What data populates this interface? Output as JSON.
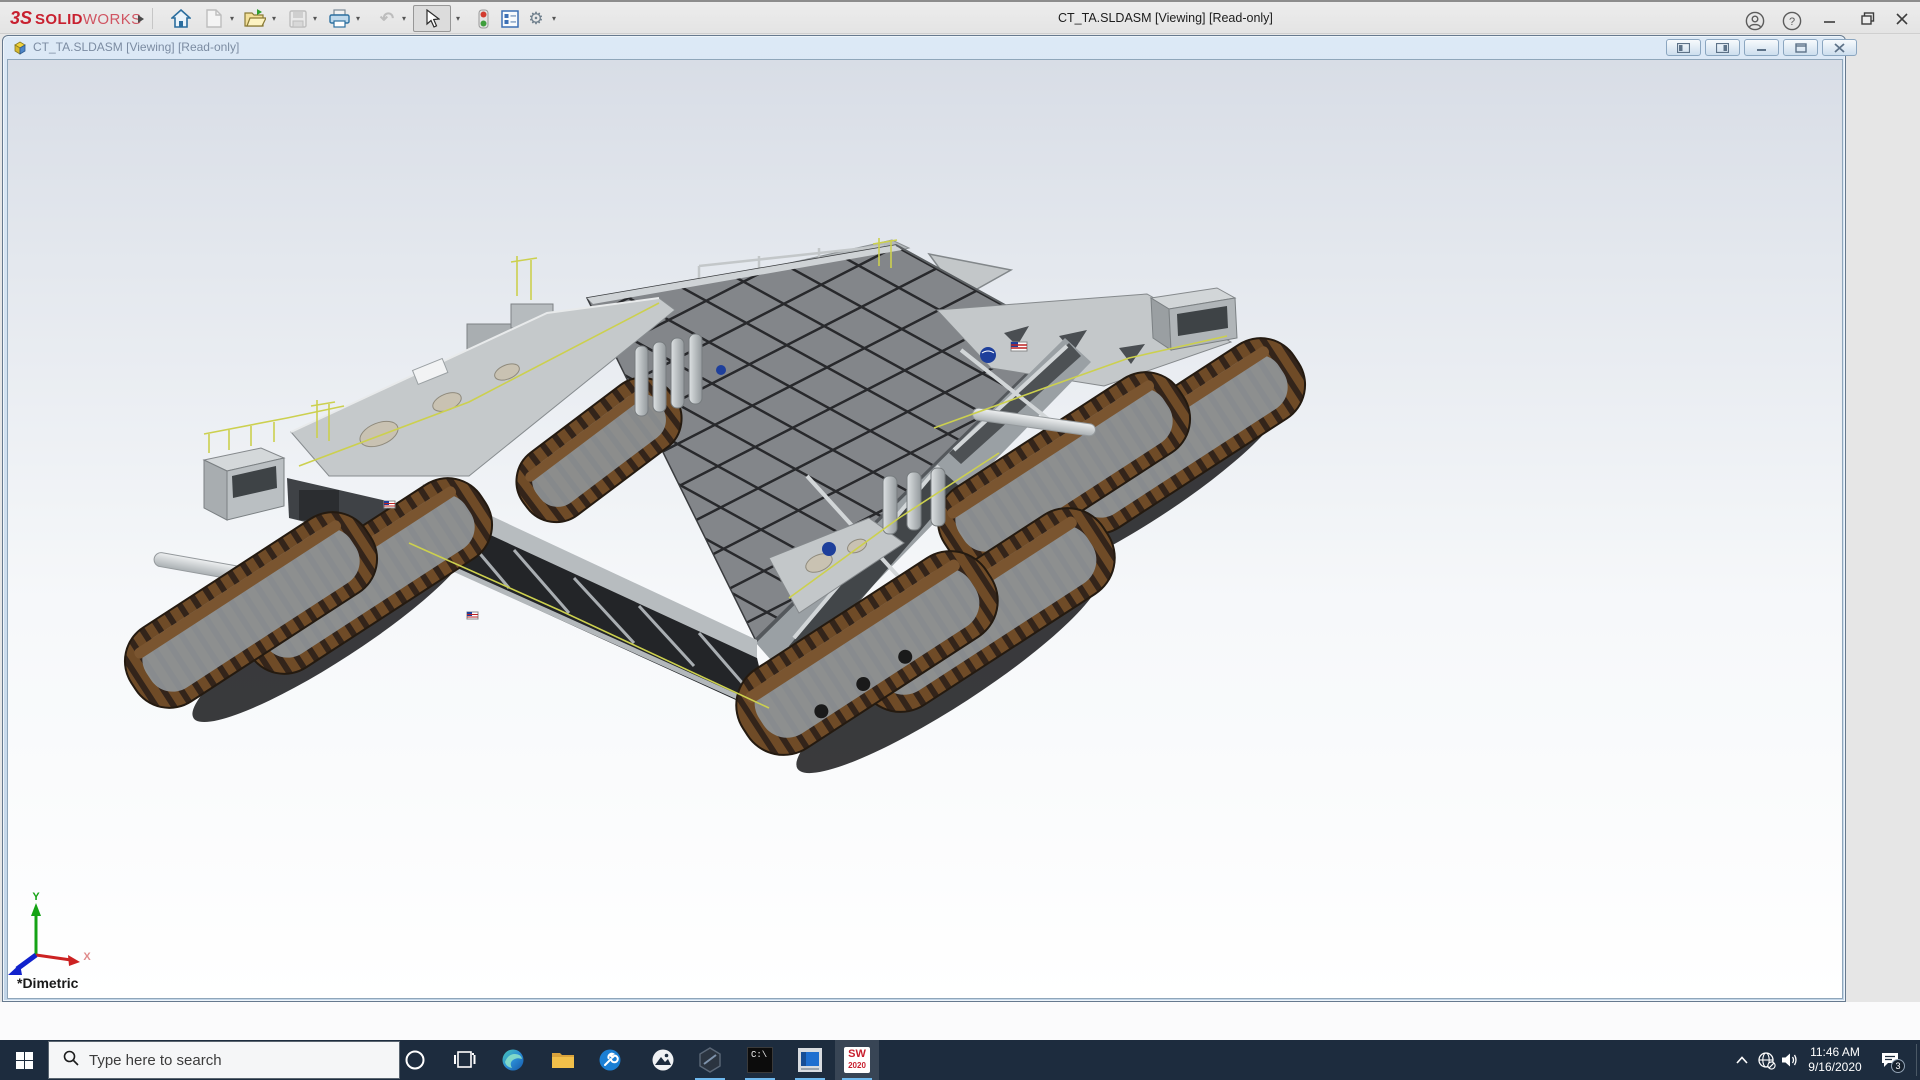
{
  "titlebar": {
    "logo_mark": "3S",
    "logo_solid": "SOLID",
    "logo_works": "WORKS",
    "title": "CT_TA.SLDASM [Viewing] [Read-only]"
  },
  "document": {
    "title": "CT_TA.SLDASM [Viewing] [Read-only]"
  },
  "viewport": {
    "view_label": "*Dimetric",
    "axis_x": "X",
    "axis_y": "Y"
  },
  "taskbar": {
    "search_placeholder": "Type here to search",
    "cmd_label": "C:\\",
    "sw_label": "SW",
    "sw_year": "2020",
    "time": "11:46 AM",
    "date": "9/16/2020",
    "notification_count": "3"
  },
  "colors": {
    "accent_blue": "#6fb9ee",
    "taskbar_bg": "#1d2c3e",
    "track_brown": "#6f4b27",
    "nasa_blue": "#1e3f9b",
    "rail_yellow": "#ccd04e",
    "logo_red": "#c8202f"
  }
}
